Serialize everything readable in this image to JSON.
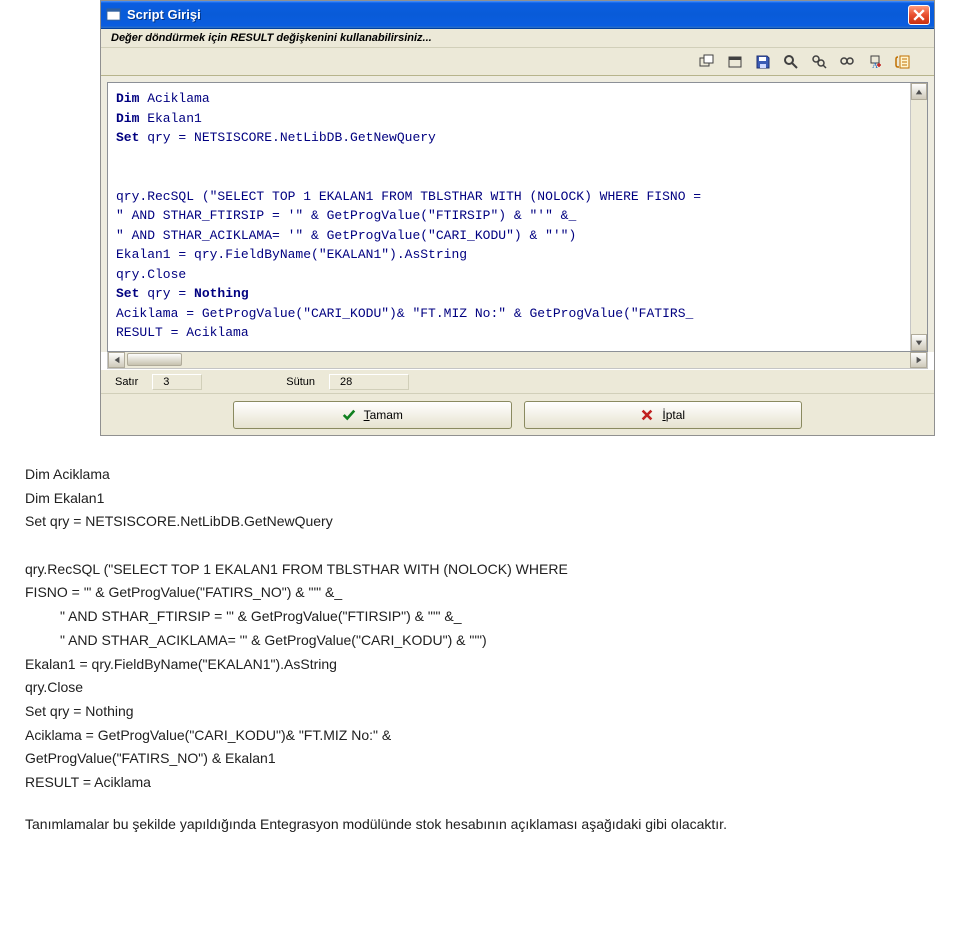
{
  "dialog": {
    "title": "Script Girişi",
    "hint": "Değer döndürmek için RESULT değişkenini kullanabilirsiniz...",
    "status": {
      "row_label": "Satır",
      "row_value": "3",
      "col_label": "Sütun",
      "col_value": "28"
    },
    "buttons": {
      "ok_label": "Tamam",
      "cancel_label": "İptal"
    },
    "editor_lines": [
      {
        "pre": "Dim",
        "rest": " Aciklama"
      },
      {
        "pre": "Dim",
        "rest": " Ekalan1"
      },
      {
        "pre": "Set",
        "rest": " qry = NETSISCORE.NetLibDB.GetNewQuery"
      },
      {
        "pre": "",
        "rest": ""
      },
      {
        "pre": "",
        "rest": ""
      },
      {
        "pre": "",
        "rest": "qry.RecSQL (\"SELECT TOP 1 EKALAN1 FROM TBLSTHAR WITH (NOLOCK) WHERE FISNO ="
      },
      {
        "pre": "",
        "rest": "\" AND STHAR_FTIRSIP = '\" & GetProgValue(\"FTIRSIP\") & \"'\" &_"
      },
      {
        "pre": "",
        "rest": "\" AND STHAR_ACIKLAMA= '\" & GetProgValue(\"CARI_KODU\") & \"'\")"
      },
      {
        "pre": "",
        "rest": "Ekalan1 = qry.FieldByName(\"EKALAN1\").AsString"
      },
      {
        "pre": "",
        "rest": "qry.Close"
      },
      {
        "pre": "Set",
        "rest": " qry = ",
        "post": "Nothing"
      },
      {
        "pre": "",
        "rest": "Aciklama =  GetProgValue(\"CARI_KODU\")& \"FT.MIZ No:\" & GetProgValue(\"FATIRS_"
      },
      {
        "pre": "",
        "rest": "RESULT = Aciklama"
      }
    ]
  },
  "doc": {
    "l1": "Dim Aciklama",
    "l2": "Dim Ekalan1",
    "l3": "Set qry = NETSISCORE.NetLibDB.GetNewQuery",
    "l4": "qry.RecSQL (\"SELECT TOP 1 EKALAN1 FROM TBLSTHAR WITH (NOLOCK) WHERE",
    "l5": "FISNO = '\" & GetProgValue(\"FATIRS_NO\") & \"'\" &_",
    "l6": "         \" AND STHAR_FTIRSIP = '\" & GetProgValue(\"FTIRSIP\") & \"'\" &_",
    "l7": "         \" AND STHAR_ACIKLAMA= '\" & GetProgValue(\"CARI_KODU\") & \"'\")",
    "l8": "Ekalan1 = qry.FieldByName(\"EKALAN1\").AsString",
    "l9": "qry.Close",
    "l10": "Set qry = Nothing",
    "l11": "Aciklama = GetProgValue(\"CARI_KODU\")& \"FT.MIZ No:\" &",
    "l12": "GetProgValue(\"FATIRS_NO\") & Ekalan1",
    "l13": "RESULT = Aciklama",
    "para": "Tanımlamalar bu şekilde yapıldığında Entegrasyon modülünde stok hesabının açıklaması aşağıdaki gibi olacaktır."
  }
}
